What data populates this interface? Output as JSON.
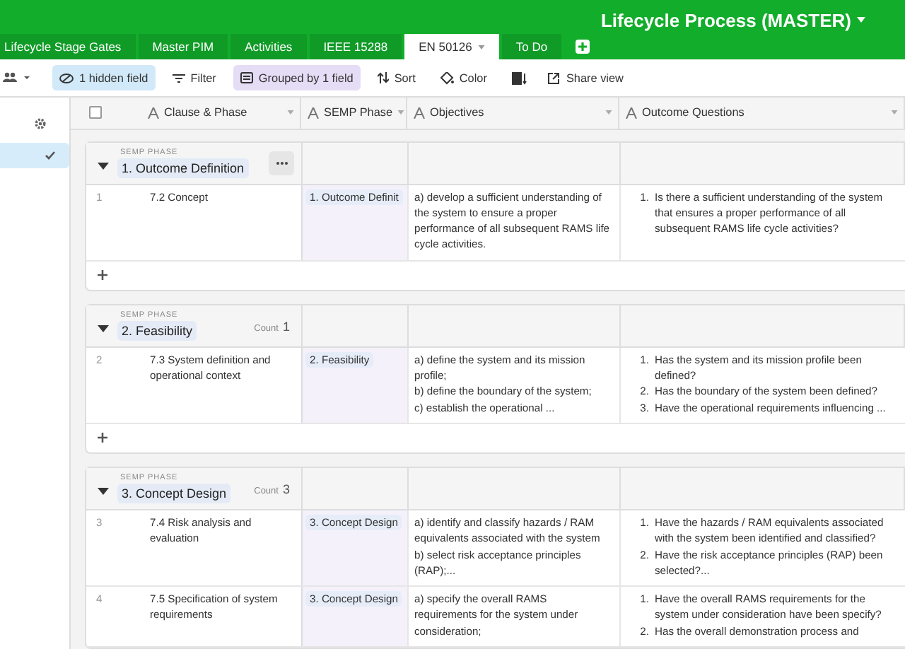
{
  "base_title": "Lifecycle Process (MASTER)",
  "tabs": [
    {
      "label": "Lifecycle Stage Gates",
      "selected": false,
      "dropdown": false
    },
    {
      "label": "Master PIM",
      "selected": false,
      "dropdown": false
    },
    {
      "label": "Activities",
      "selected": false,
      "dropdown": false
    },
    {
      "label": "IEEE 15288",
      "selected": false,
      "dropdown": false
    },
    {
      "label": "EN 50126",
      "selected": true,
      "dropdown": true
    },
    {
      "label": "To Do",
      "selected": false,
      "dropdown": false
    }
  ],
  "toolbar": {
    "hidden_fields": "1 hidden field",
    "filter": "Filter",
    "grouped": "Grouped by 1 field",
    "sort": "Sort",
    "color_label": "Color",
    "share": "Share view"
  },
  "sidebar": {
    "items": [
      {
        "selected": true
      }
    ]
  },
  "header_checkbox": {
    "checked": false
  },
  "columns": [
    {
      "label": "Clause & Phase"
    },
    {
      "label": "SEMP Phase"
    },
    {
      "label": "Objectives"
    },
    {
      "label": "Outcome Questions"
    }
  ],
  "groups": [
    {
      "field_label": "SEMP PHASE",
      "name": "1. Outcome Definition",
      "menu_button": true,
      "rows": [
        {
          "number": "1",
          "clause": "7.2 Concept",
          "semp": "1. Outcome Definit",
          "objectives": "a)  develop a sufficient understanding of the system to ensure a proper performance of all subsequent RAMS life cycle activities.",
          "questions": [
            {
              "number": "1.",
              "text": "Is there a sufficient understanding of the system that ensures a proper performance of all subsequent RAMS life cycle activities?"
            }
          ]
        }
      ]
    },
    {
      "field_label": "SEMP PHASE",
      "name": "2. Feasibility",
      "count_label": "Count",
      "count": "1",
      "menu_button": false,
      "rows": [
        {
          "number": "2",
          "clause": "7.3 System definition and operational context",
          "semp": "2. Feasibility",
          "objectives": "a) define the system and its mission profile;\nb) define the boundary of the system;\nc) establish the operational ...",
          "questions": [
            {
              "number": "1.",
              "text": "Has the system and its mission profile been defined?"
            },
            {
              "number": "2.",
              "text": "Has the boundary of the system been defined?"
            },
            {
              "number": "3.",
              "text": "Have the operational requirements influencing ..."
            }
          ]
        }
      ]
    },
    {
      "field_label": "SEMP PHASE",
      "name": "3. Concept Design",
      "count_label": "Count",
      "count": "3",
      "menu_button": false,
      "rows": [
        {
          "number": "3",
          "clause": "7.4 Risk analysis and evaluation",
          "semp": "3. Concept Design",
          "objectives": "a) identify and classify hazards / RAM equivalents associated with the system\nb) select risk acceptance principles (RAP);...",
          "questions": [
            {
              "number": "1.",
              "text": "Have the hazards / RAM equivalents associated with the system been identified and classified?"
            },
            {
              "number": "2.",
              "text": "Have the risk acceptance principles (RAP) been selected?..."
            }
          ]
        },
        {
          "number": "4",
          "clause": "7.5 Specification of system requirements",
          "semp": "3. Concept Design",
          "objectives": "a) specify the overall RAMS requirements for the system under consideration;",
          "questions": [
            {
              "number": "1.",
              "text": "Have the overall RAMS requirements for the system under consideration have been specify?"
            },
            {
              "number": "2.",
              "text": "Has the overall demonstration process and"
            }
          ]
        }
      ]
    }
  ]
}
